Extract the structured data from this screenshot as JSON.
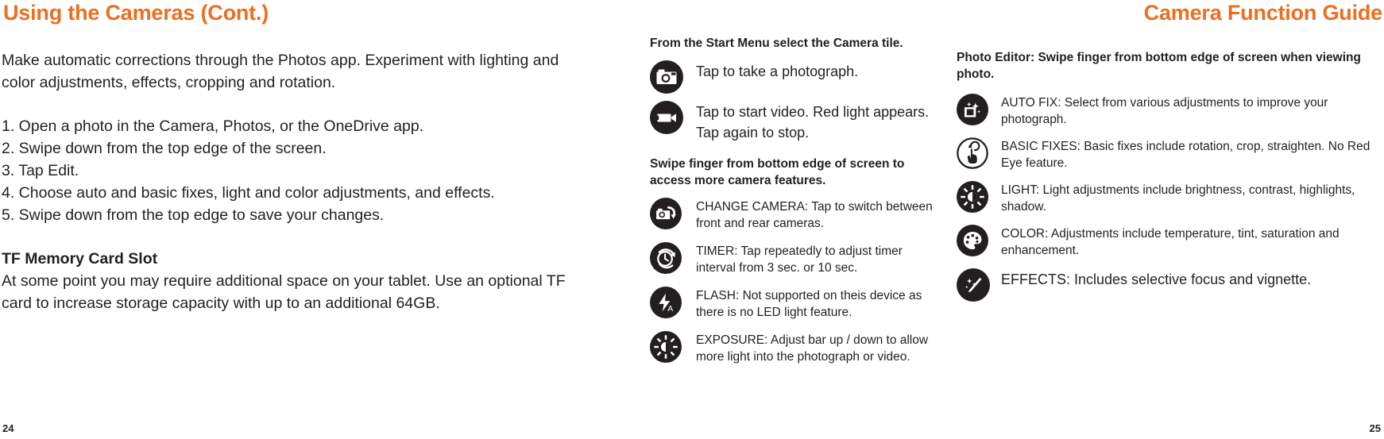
{
  "headings": {
    "left": "Using the Cameras (Cont.)",
    "right": "Camera Function Guide"
  },
  "left_column": {
    "intro": "Make automatic corrections through the Photos app. Experiment with lighting and color adjustments, effects, cropping and rotation.",
    "steps": [
      "1. Open a photo in the Camera, Photos, or the OneDrive app.",
      "2. Swipe down from the top edge of the screen.",
      "3. Tap Edit.",
      "4. Choose auto and basic fixes, light and color adjustments, and effects.",
      "5. Swipe down from the top edge to save your changes."
    ],
    "section_title": "TF Memory Card Slot",
    "section_body": "At some point you may require additional space on your tablet. Use an optional TF card to increase storage capacity with up to an additional 64GB."
  },
  "middle_column": {
    "lead_1": "From the Start Menu select the Camera tile.",
    "primary_items": [
      {
        "icon": "camera-icon",
        "text": "Tap to take a photograph."
      },
      {
        "icon": "video-camera-icon",
        "text": "Tap to start video.  Red light appears.\nTap again to stop."
      }
    ],
    "lead_2": "Swipe finger from bottom edge of screen to access more camera features.",
    "feature_items": [
      {
        "icon": "change-camera-icon",
        "text": "CHANGE CAMERA: Tap to switch between front and rear cameras."
      },
      {
        "icon": "timer-icon",
        "text": "TIMER: Tap repeatedly to adjust timer interval from 3 sec. or 10 sec."
      },
      {
        "icon": "flash-auto-icon",
        "text": "FLASH: Not supported on theis device as there is no LED light feature."
      },
      {
        "icon": "exposure-icon",
        "text": "EXPOSURE: Adjust bar up / down to allow more light into the photograph or video."
      }
    ]
  },
  "right_column": {
    "lead": "Photo Editor: Swipe finger from bottom edge of screen when viewing photo.",
    "items": [
      {
        "icon": "auto-fix-icon",
        "text": "AUTO FIX: Select from various adjustments to improve your photograph."
      },
      {
        "icon": "basic-fixes-icon",
        "text": "BASIC FIXES: Basic fixes include rotation, crop, straighten.  No Red Eye feature."
      },
      {
        "icon": "light-icon",
        "text": "LIGHT: Light adjustments include brightness, contrast, highlights, shadow."
      },
      {
        "icon": "color-palette-icon",
        "text": "COLOR: Adjustments include temperature, tint, saturation and enhancement."
      },
      {
        "icon": "effects-icon",
        "text": "EFFECTS: Includes selective focus and vignette."
      }
    ]
  },
  "page_numbers": {
    "left": "24",
    "right": "25"
  },
  "colors": {
    "heading_orange": "#ec6e1f",
    "body_text": "#231f20",
    "icon_fill": "#231f20"
  }
}
